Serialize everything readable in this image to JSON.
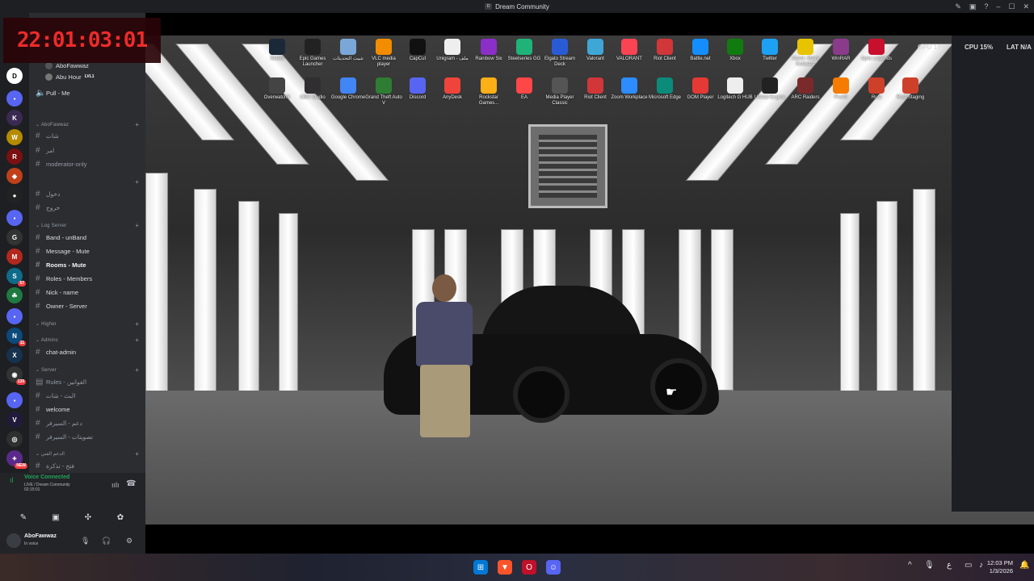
{
  "window": {
    "title": "Dream Community"
  },
  "overlay": {
    "timer": "22:01:03:01"
  },
  "sidebar": {
    "voice_users": [
      {
        "name": "AboFawwaz"
      },
      {
        "name": "Abu Hour",
        "badge": "LVL1"
      }
    ],
    "pull_channel": "Pull - Me",
    "categories": [
      {
        "name": "AboFawwaz",
        "channels": [
          "شات",
          "امر",
          "moderator-only"
        ]
      },
      {
        "name": "",
        "channels": [
          "دخول",
          "خروج"
        ]
      },
      {
        "name": "Log Server",
        "channels": [
          "Band - unBand",
          "Message - Mute",
          "Rooms - Mute",
          "Roles - Members",
          "Nick - name",
          "Owner - Server"
        ]
      },
      {
        "name": "Higher",
        "channels": []
      },
      {
        "name": "Admins",
        "channels": [
          "chat-admin"
        ]
      },
      {
        "name": "Server",
        "channels": [
          "Rules - القوانين",
          "البث - شات",
          "welcome",
          "دعم - السيرفر",
          "تصويتات - السيرفر"
        ]
      },
      {
        "name": "الدعم الفني",
        "channels": [
          "فتح - تذكرة"
        ]
      }
    ],
    "active_channel": "Rooms - Mute"
  },
  "voice": {
    "status": "Voice Connected",
    "channel": "LIVE / Dream Community",
    "elapsed": "02:15:01"
  },
  "user": {
    "name": "AboFawwaz",
    "status": "In voice"
  },
  "rail": {
    "badges": [
      "57",
      "11",
      "139",
      "NEW"
    ]
  },
  "stream": {
    "perf": [
      "GPU 19%",
      "CPU 15%",
      "LAT N/A"
    ],
    "desktop_icons_row1": [
      "Steam",
      "Epic Games Launcher",
      "تثبيت التحديثات",
      "VLC media player",
      "CapCut",
      "Unigram - ملف",
      "Rainbow Six",
      "Steelseries GG",
      "Elgato Stream Deck",
      "Valorant",
      "VALORANT",
      "Riot Client",
      "Battle.net",
      "Xbox",
      "Twitter",
      "Attack Shark Software",
      "WinRAR",
      "Apex Legends"
    ],
    "desktop_icons_row2": [
      "OverwatchK",
      "OBS Studio",
      "Google Chrome",
      "Grand Theft Auto V",
      "Discord",
      "AnyDesk",
      "Rockstar Games...",
      "EA",
      "Media Player Classic",
      "Riot Client",
      "Zoom Workplace",
      "Microsoft Edge",
      "GOM Player",
      "Logitech G HUB",
      "Unreal Engine",
      "ARC Raiders",
      "FiveM",
      "Rust",
      "Rust Staging"
    ]
  },
  "taskbar": {
    "time": "12:03 PM",
    "date": "1/3/2026",
    "lang": "ع"
  }
}
